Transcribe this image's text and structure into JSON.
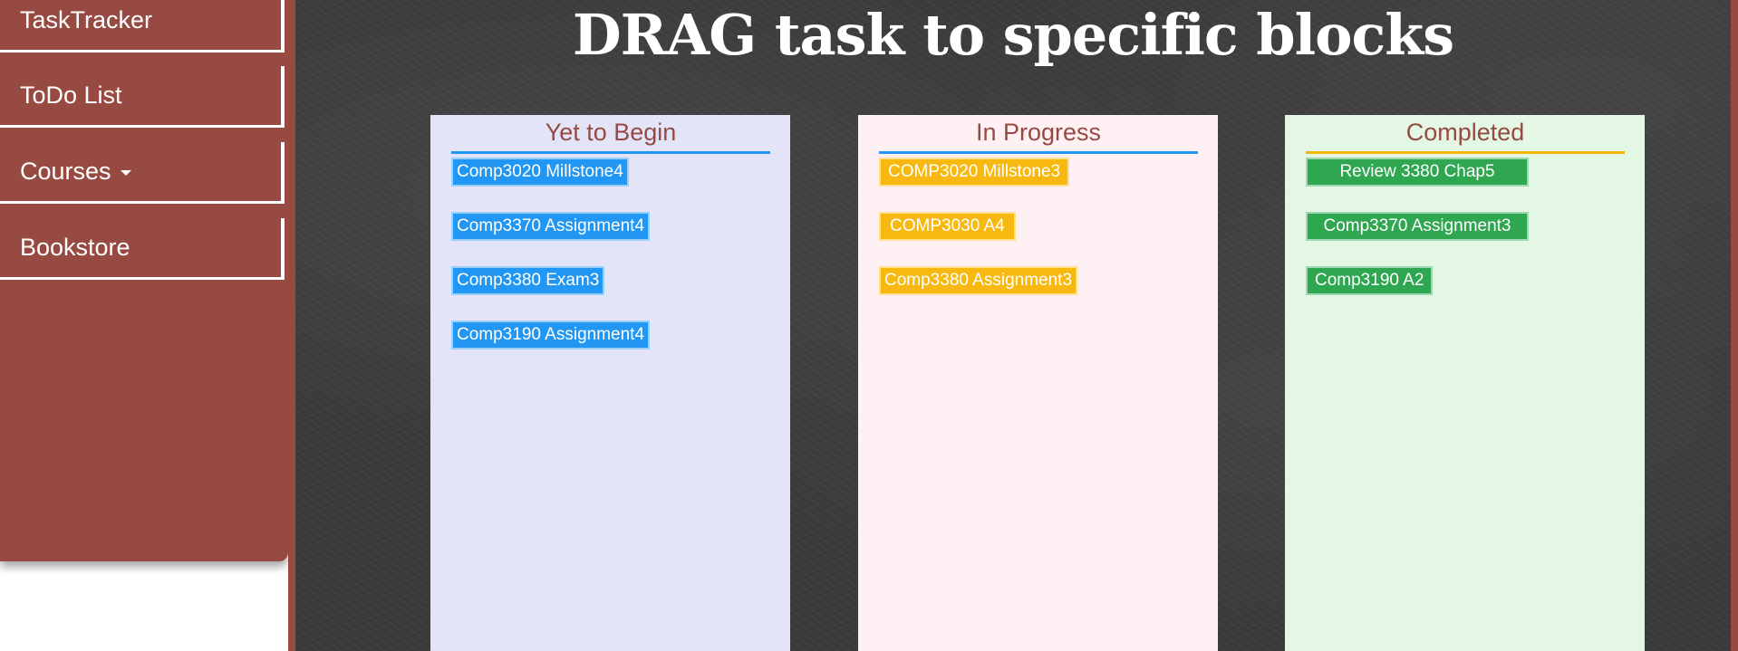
{
  "sidebar": {
    "items": [
      {
        "label": "TaskTracker"
      },
      {
        "label": "ToDo List"
      },
      {
        "label": "Courses"
      },
      {
        "label": "Bookstore"
      }
    ]
  },
  "main": {
    "title": "DRAG task to specific blocks",
    "columns": [
      {
        "title": "Yet to Begin",
        "background": "#e4e4f8",
        "tasks": [
          "Comp3020 Millstone4",
          "Comp3370 Assignment4",
          "Comp3380 Exam3",
          "Comp3190 Assignment4"
        ]
      },
      {
        "title": "In Progress",
        "background": "#fff0f4",
        "tasks": [
          "COMP3020 Millstone3",
          "COMP3030 A4",
          "Comp3380 Assignment3"
        ]
      },
      {
        "title": "Completed",
        "background": "#e4f7e4",
        "tasks": [
          "Review 3380 Chap5",
          "Comp3370 Assignment3",
          "Comp3190 A2"
        ]
      }
    ]
  },
  "colors": {
    "sidebar": "#974a42",
    "task_blue": "#2196f3",
    "task_yellow": "#f7b90f",
    "task_green": "#2fa650",
    "header_text": "#974a42"
  }
}
